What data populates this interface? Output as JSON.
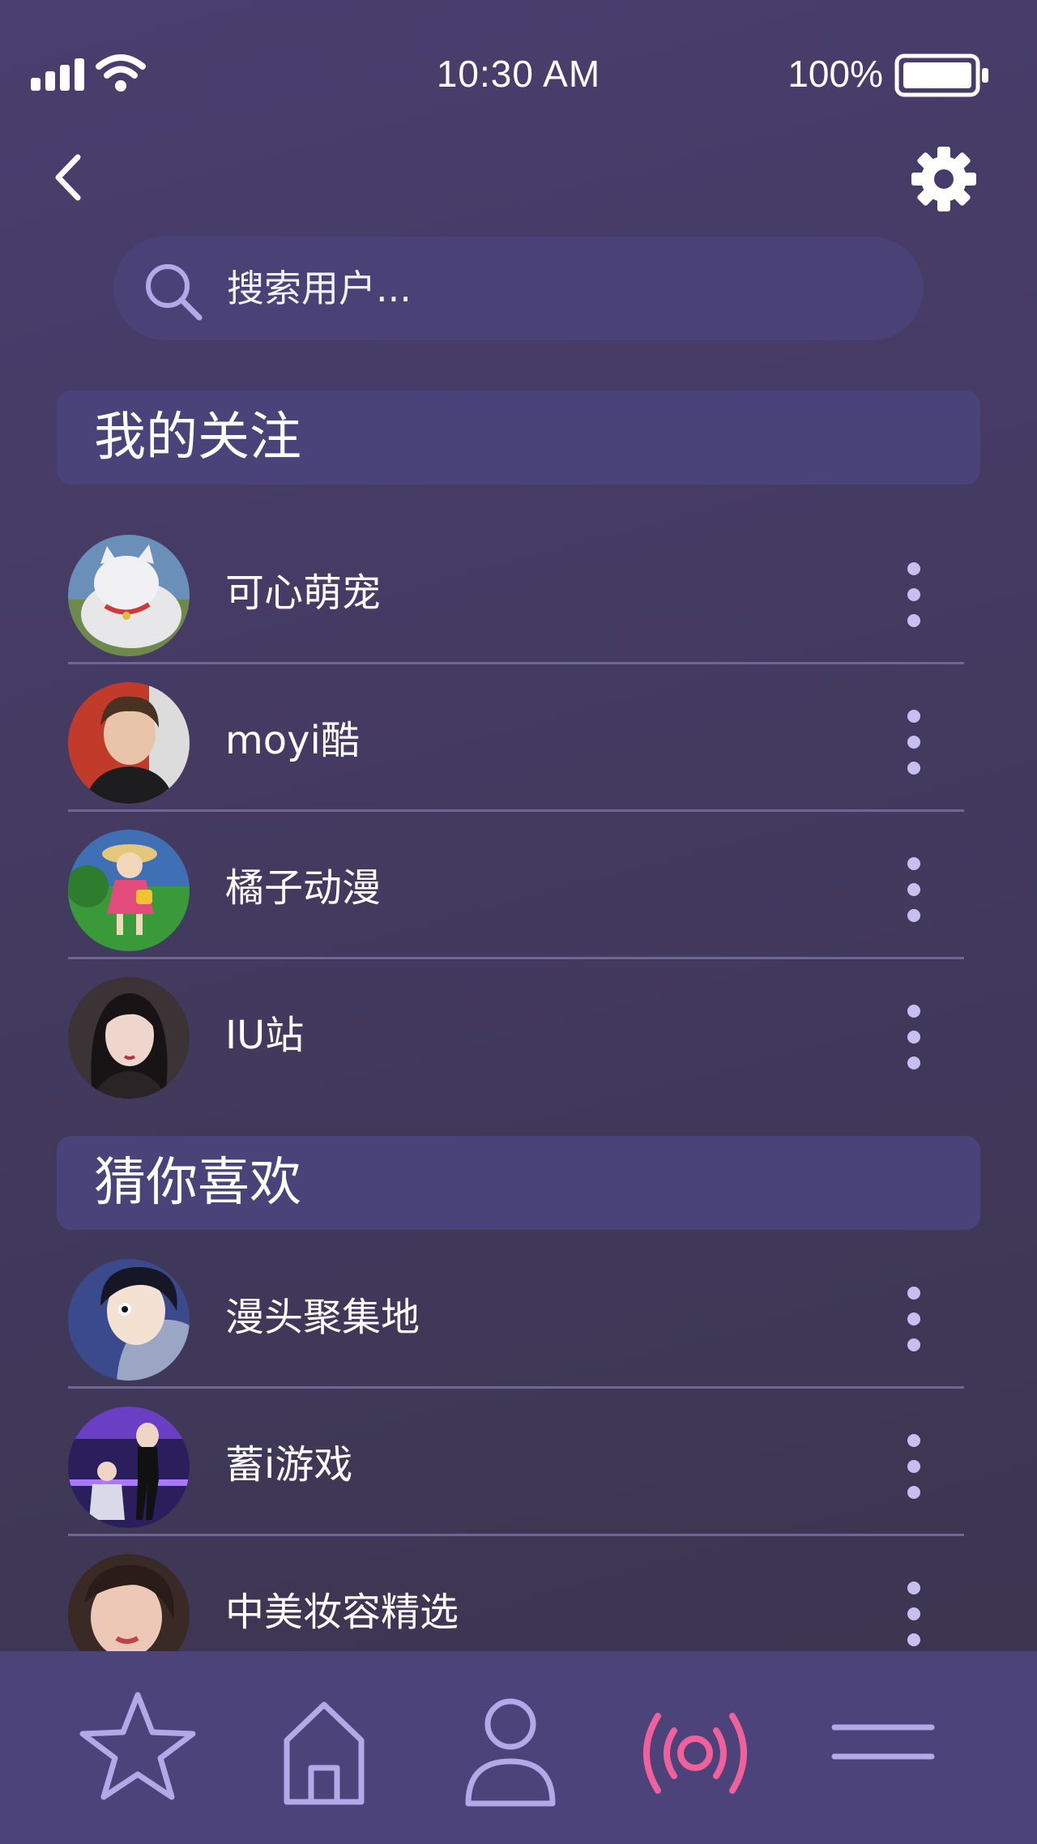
{
  "status_bar": {
    "time": "10:30 AM",
    "battery_percent": "100%",
    "icons": [
      "signal-icon",
      "wifi-icon",
      "battery-icon"
    ]
  },
  "header": {
    "back_icon": "chevron-left-icon",
    "settings_icon": "gear-icon"
  },
  "search": {
    "placeholder": "搜索用户...",
    "icon": "search-icon"
  },
  "following": {
    "title": "我的关注",
    "items": [
      {
        "name": "可心萌宠"
      },
      {
        "name": "moyi酷"
      },
      {
        "name": "橘子动漫"
      },
      {
        "name": "IU站"
      }
    ]
  },
  "recommended": {
    "title": "猜你喜欢",
    "items": [
      {
        "name": "漫头聚集地"
      },
      {
        "name": "蓄i游戏"
      },
      {
        "name": "中美妆容精选"
      }
    ]
  },
  "tab_bar": {
    "tabs": [
      {
        "icon": "star-icon",
        "active": false
      },
      {
        "icon": "home-icon",
        "active": false
      },
      {
        "icon": "person-icon",
        "active": false
      },
      {
        "icon": "broadcast-icon",
        "active": true
      },
      {
        "icon": "menu-icon",
        "active": false
      }
    ]
  },
  "colors": {
    "accent": "#f0609a",
    "icon_light": "#b3a8e8",
    "background": "#433a60",
    "panel": "#4a4379"
  }
}
